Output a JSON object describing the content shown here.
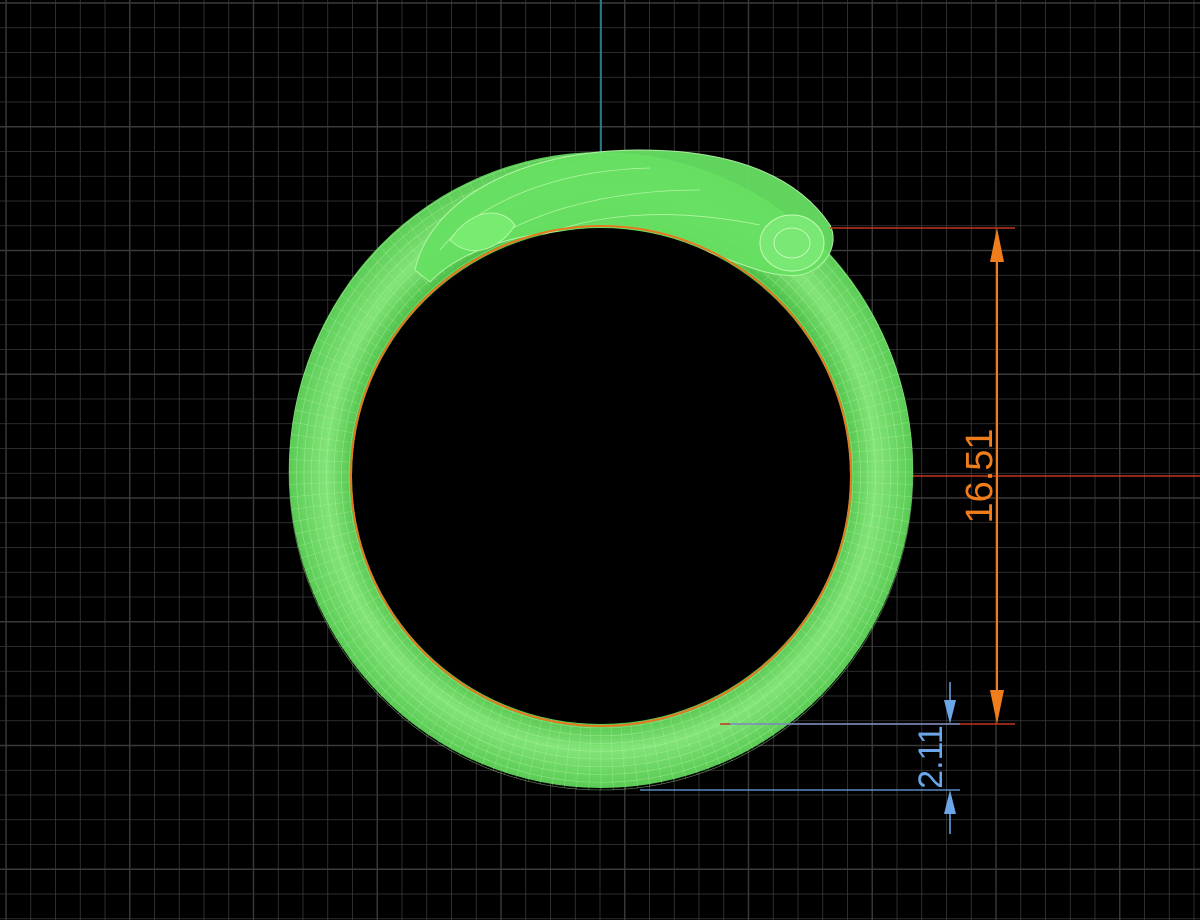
{
  "viewport": {
    "background": "#000000",
    "grid_color": "#3a3a3a",
    "center_axis_color": "#2a8fa6",
    "horizontal_axis_color": "#c0351c"
  },
  "ring": {
    "mesh_color": "#6fe86a",
    "mesh_line_color": "#b7f7a8",
    "inner_circle_color": "#e87820"
  },
  "dimensions": {
    "inner_diameter": {
      "label": "16.51",
      "color": "#f07d1c"
    },
    "thickness": {
      "label": "2.11",
      "color": "#6aa6e8"
    }
  }
}
